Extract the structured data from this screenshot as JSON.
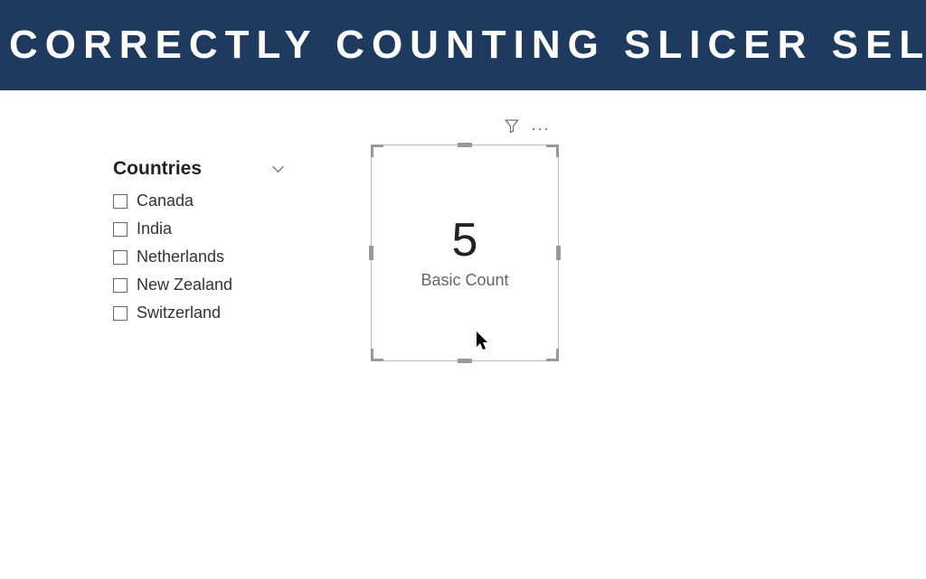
{
  "header": {
    "title": "CORRECTLY COUNTING SLICER SEL"
  },
  "slicer": {
    "title": "Countries",
    "items": [
      {
        "label": "Canada"
      },
      {
        "label": "India"
      },
      {
        "label": "Netherlands"
      },
      {
        "label": "New Zealand"
      },
      {
        "label": "Switzerland"
      }
    ]
  },
  "card": {
    "value": "5",
    "label": "Basic Count"
  },
  "toolbar": {
    "more": "···"
  }
}
